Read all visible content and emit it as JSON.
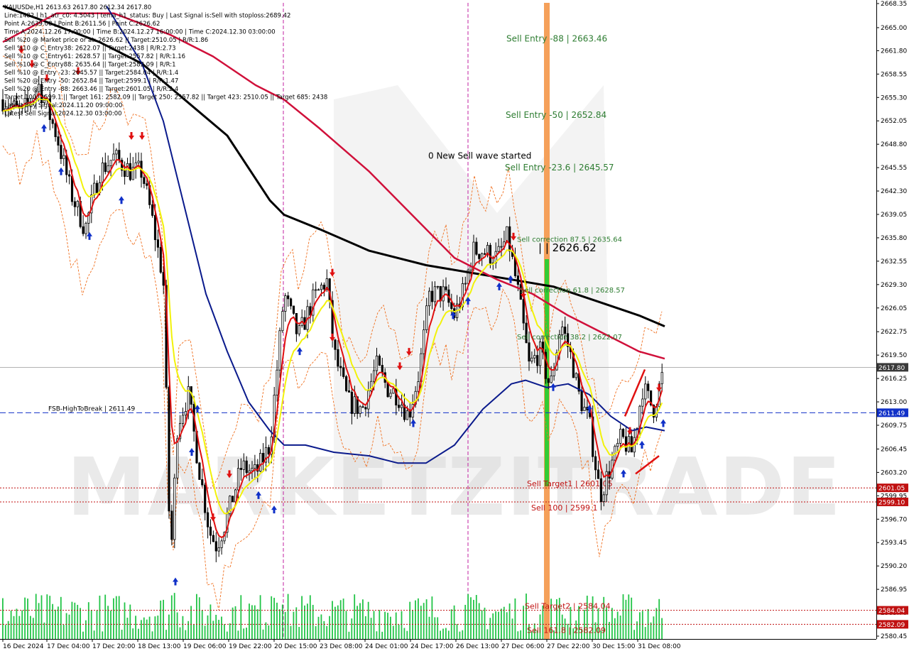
{
  "header": {
    "lines": [
      "XAUUSDe,H1  2613.63 2617.80 2612.34 2617.80",
      "Line:1482 | h1_atr_c0: 4.5043 | tema_h1_status: Buy | Last Signal is:Sell with stoploss:2689.42",
      "Point A:2639.08 | Point B:2611.56 | Point C:2626.62",
      "Time A:2024.12.26 17:00:00 | Time B:2024.12.27 16:00:00 | Time C:2024.12.30 03:00:00",
      "Sell %20 @ Market price or at: 2626.62 || Target:2510.05 | R/R:1.86",
      "Sell %10 @ C_Entry38: 2622.07 || Target:2438 | R/R:2.73",
      "Sell %10 @ C_Entry61: 2628.57 || Target:2557.82 | R/R:1.16",
      "Sell %10 @ C_Entry88: 2635.64 || Target:2582.09 | R/R:1",
      "Sell %10 @ Entry -23: 2645.57 || Target:2584.04 | R/R:1.4",
      "Sell %20 @ Entry -50: 2652.84 || Target:2599.1 | R/R:1.47",
      "Sell %20 @ Entry -88: 2663.46 || Target:2601.05 | R/R:2.4",
      "Target 100: 2599.1 || Target 161: 2582.09 || Target 250: 2557.82 || Target 423: 2510.05 || Target 685: 2438",
      "Latest Buy Signal:2024.11.20 09:00:00",
      "Latest Sell Signal:2024.12.30 03:00:00"
    ]
  },
  "chart_data": {
    "type": "candlestick",
    "symbol": "XAUUSDe,H1",
    "ylim": [
      2580.0,
      2668.35
    ],
    "y_ticks": [
      "2668.35",
      "2665.00",
      "2661.80",
      "2658.55",
      "2655.30",
      "2652.05",
      "2648.80",
      "2645.55",
      "2642.30",
      "2639.05",
      "2635.80",
      "2632.55",
      "2629.30",
      "2626.05",
      "2622.75",
      "2619.50",
      "2616.25",
      "2613.00",
      "2609.75",
      "2606.45",
      "2603.20",
      "2599.95",
      "2596.70",
      "2593.45",
      "2590.20",
      "2586.95",
      "2583.70",
      "2580.45"
    ],
    "x_ticks": [
      "16 Dec 2024",
      "17 Dec 04:00",
      "17 Dec 20:00",
      "18 Dec 13:00",
      "19 Dec 06:00",
      "19 Dec 22:00",
      "20 Dec 15:00",
      "23 Dec 08:00",
      "24 Dec 01:00",
      "24 Dec 17:00",
      "26 Dec 13:00",
      "27 Dec 06:00",
      "27 Dec 22:00",
      "30 Dec 15:00",
      "31 Dec 08:00"
    ],
    "current_price": "2617.80",
    "price_labels": [
      {
        "value": 2617.8,
        "text": "2617.80",
        "color": "#3a3a3a"
      },
      {
        "value": 2611.49,
        "text": "2611.49",
        "color": "#1030c8"
      },
      {
        "value": 2601.05,
        "text": "2601.05",
        "color": "#c01010"
      },
      {
        "value": 2599.1,
        "text": "2599.10",
        "color": "#c01010"
      },
      {
        "value": 2584.04,
        "text": "2584.04",
        "color": "#c01010"
      },
      {
        "value": 2582.09,
        "text": "2582.09",
        "color": "#c01010"
      }
    ],
    "levels": [
      {
        "name": "FSB-HighToBreak",
        "text": "FSB-HighToBreak | 2611.49",
        "value": 2611.49,
        "color": "#1030c8",
        "style": "dashed"
      },
      {
        "name": "Sell Target1",
        "text": "Sell Target1 | 2601.05",
        "value": 2601.05,
        "color": "#c01010"
      },
      {
        "name": "Sell 100",
        "text": "Sell 100 | 2599.1",
        "value": 2599.1,
        "color": "#c01010"
      },
      {
        "name": "Sell Target2",
        "text": "Sell Target2 | 2584.04",
        "value": 2584.04,
        "color": "#c01010"
      },
      {
        "name": "Sell 161.8",
        "text": "Sell 161.8 | 2582.09",
        "value": 2582.09,
        "color": "#c01010"
      }
    ],
    "annotations": [
      {
        "text": "Sell Entry -88 | 2663.46",
        "value": 2663.46,
        "color": "#2e7d32"
      },
      {
        "text": "Sell Entry -50 | 2652.84",
        "value": 2652.84,
        "color": "#2e7d32"
      },
      {
        "text": "0 New Sell wave started",
        "value": 2647.2,
        "color": "#000000"
      },
      {
        "text": "Sell Entry -23.6 | 2645.57",
        "value": 2645.57,
        "color": "#2e7d32"
      },
      {
        "text": "Sell correction 87.5 | 2635.64",
        "value": 2635.64,
        "color": "#2e7d32"
      },
      {
        "text": "| | 2626.62",
        "value": 2634.3,
        "color": "#000000"
      },
      {
        "text": "Sell correction 61.8 | 2628.57",
        "value": 2628.57,
        "color": "#2e7d32"
      },
      {
        "text": "Sell correction 38.2 | 2622.07",
        "value": 2622.07,
        "color": "#2e7d32"
      }
    ],
    "watermark": "MARKETZITRADE",
    "colors": {
      "bull": "#17b24a",
      "bear": "#17b24a",
      "ma_black": "#000000",
      "ma_crimson": "#d0103a",
      "ma_navy": "#0a1a8c",
      "ema_red": "#e01010",
      "ema_yellow": "#f2f20a",
      "arrow_up": "#1030c8",
      "arrow_down": "#e01010",
      "volume": "#22c447",
      "sell_bar": "#f5a05a",
      "buy_bar": "#33cc33"
    }
  }
}
